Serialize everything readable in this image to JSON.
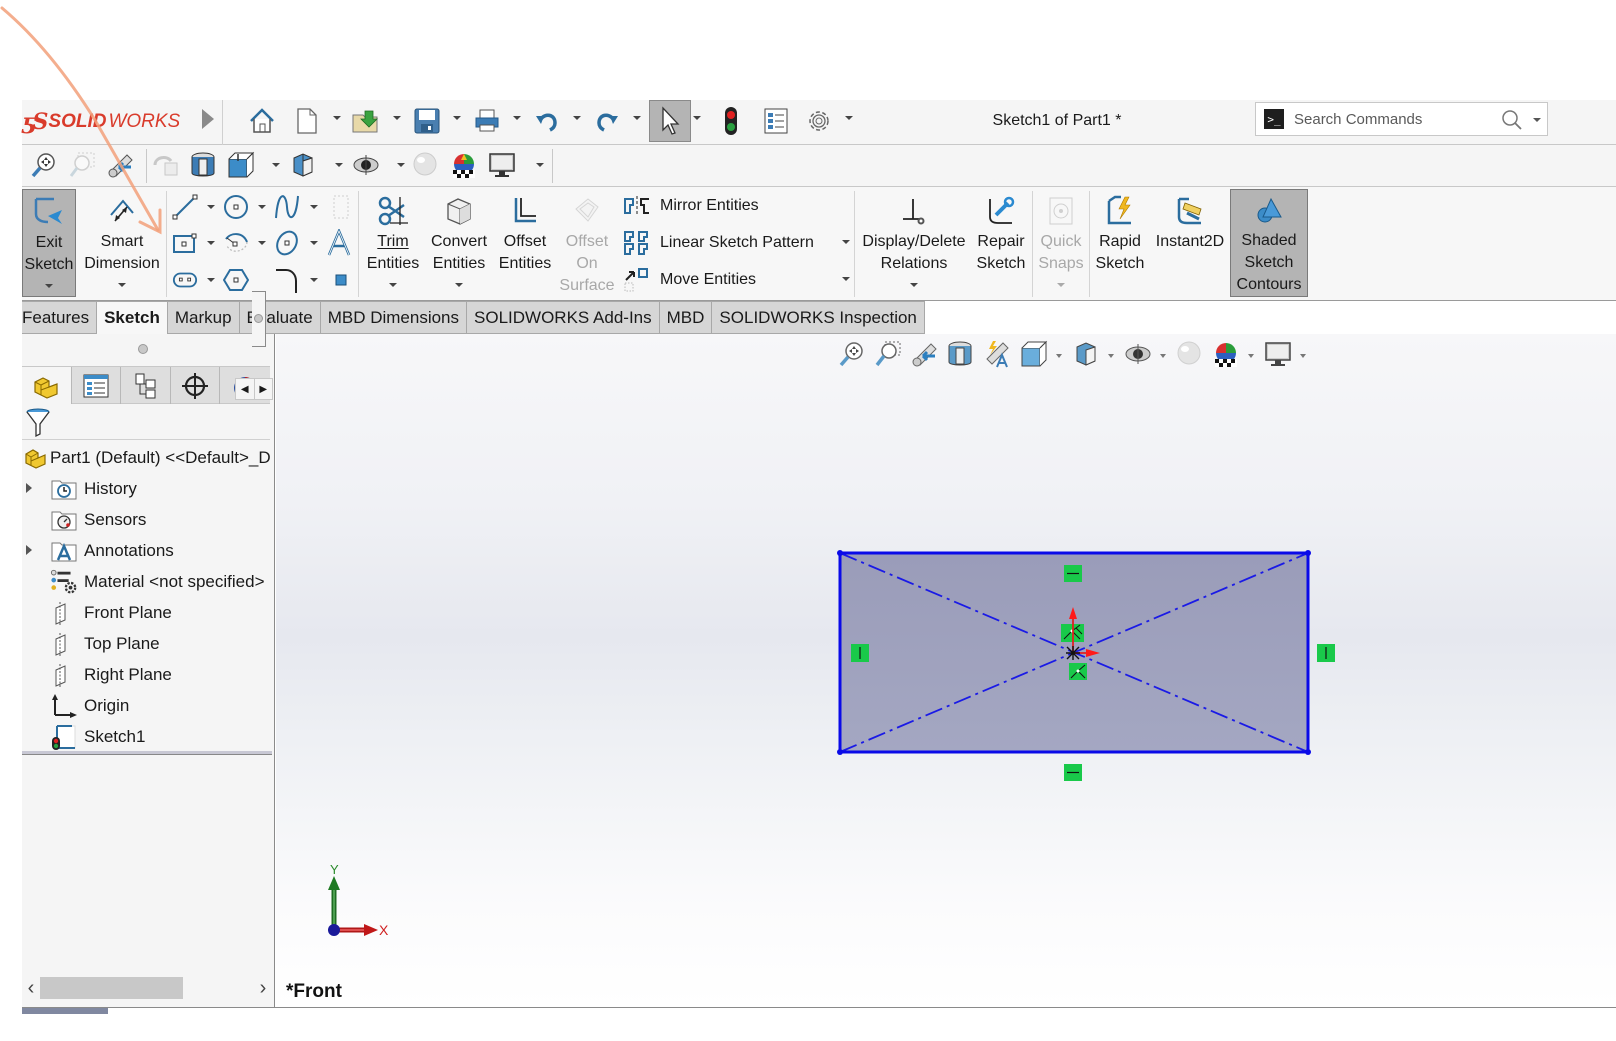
{
  "app": {
    "brand_ds": "ƽS",
    "brand_solid": "SOLID",
    "brand_works": "WORKS",
    "document_title": "Sketch1 of Part1 *"
  },
  "search": {
    "placeholder": "Search Commands",
    "value": ""
  },
  "quick_access": [
    {
      "name": "home",
      "icon": "home-icon"
    },
    {
      "name": "new",
      "icon": "new-document-icon",
      "dropdown": true
    },
    {
      "name": "open",
      "icon": "open-folder-icon",
      "dropdown": true
    },
    {
      "name": "save",
      "icon": "save-icon",
      "dropdown": true
    },
    {
      "name": "print",
      "icon": "print-icon",
      "dropdown": true
    },
    {
      "name": "undo",
      "icon": "undo-icon",
      "dropdown": true
    },
    {
      "name": "redo",
      "icon": "redo-icon",
      "dropdown": true
    },
    {
      "name": "select",
      "icon": "cursor-icon",
      "dropdown": true,
      "selected": true
    },
    {
      "name": "rebuild",
      "icon": "traffic-light-icon"
    },
    {
      "name": "file-properties",
      "icon": "properties-icon"
    },
    {
      "name": "options",
      "icon": "gear-icon",
      "dropdown": true
    }
  ],
  "view_toolbar": [
    "zoom-to-fit-icon",
    "zoom-to-area-icon",
    "previous-view-icon",
    "rebuild-view-icon",
    "section-view-icon",
    "view-orientation-icon",
    "display-style-icon",
    "hide-show-items-icon",
    "edit-appearance-icon",
    "apply-scene-icon",
    "view-settings-icon"
  ],
  "ribbon": {
    "exit_sketch": {
      "line1": "Exit",
      "line2": "Sketch"
    },
    "smart_dimension": {
      "line1": "Smart",
      "line2": "Dimension"
    },
    "trim": {
      "line1": "Trim",
      "line2": "Entities"
    },
    "convert": {
      "line1": "Convert",
      "line2": "Entities"
    },
    "offset": {
      "line1": "Offset",
      "line2": "Entities"
    },
    "offset_surface": {
      "line1": "Offset",
      "line2": "On",
      "line3": "Surface"
    },
    "mirror": "Mirror Entities",
    "linear_pattern": "Linear Sketch Pattern",
    "move": "Move Entities",
    "display_delete": {
      "line1": "Display/Delete",
      "line2": "Relations"
    },
    "repair": {
      "line1": "Repair",
      "line2": "Sketch"
    },
    "quick_snaps": {
      "line1": "Quick",
      "line2": "Snaps"
    },
    "rapid_sketch": {
      "line1": "Rapid",
      "line2": "Sketch"
    },
    "instant2d": {
      "line1": "Instant2D"
    },
    "shaded_contours": {
      "line1": "Shaded",
      "line2": "Sketch",
      "line3": "Contours"
    }
  },
  "tabs": [
    {
      "label": "Features",
      "active": false
    },
    {
      "label": "Sketch",
      "active": true
    },
    {
      "label": "Markup",
      "active": false
    },
    {
      "label": "Evaluate",
      "active": false
    },
    {
      "label": "MBD Dimensions",
      "active": false
    },
    {
      "label": "SOLIDWORKS Add-Ins",
      "active": false
    },
    {
      "label": "MBD",
      "active": false
    },
    {
      "label": "SOLIDWORKS Inspection",
      "active": false
    }
  ],
  "feature_tree": {
    "root": "Part1 (Default) <<Default>_D",
    "items": [
      {
        "label": "History",
        "icon": "history-folder-icon",
        "expandable": true
      },
      {
        "label": "Sensors",
        "icon": "sensors-folder-icon",
        "expandable": false
      },
      {
        "label": "Annotations",
        "icon": "annotations-folder-icon",
        "expandable": true
      },
      {
        "label": "Material <not specified>",
        "icon": "material-icon",
        "expandable": false
      },
      {
        "label": "Front Plane",
        "icon": "plane-icon",
        "expandable": false
      },
      {
        "label": "Top Plane",
        "icon": "plane-icon",
        "expandable": false
      },
      {
        "label": "Right Plane",
        "icon": "plane-icon",
        "expandable": false
      },
      {
        "label": "Origin",
        "icon": "origin-icon",
        "expandable": false
      },
      {
        "label": "Sketch1",
        "icon": "sketch-icon",
        "expandable": false
      }
    ]
  },
  "viewport": {
    "view_name": "*Front",
    "triad_x": "X",
    "triad_y": "Y"
  },
  "colors": {
    "brand_red": "#d93b2b",
    "sketch_blue": "#0000e6",
    "relation_green": "#19c94a",
    "sketch_fill": "#9c9fbc",
    "annotation_orange": "#f2a07a"
  }
}
